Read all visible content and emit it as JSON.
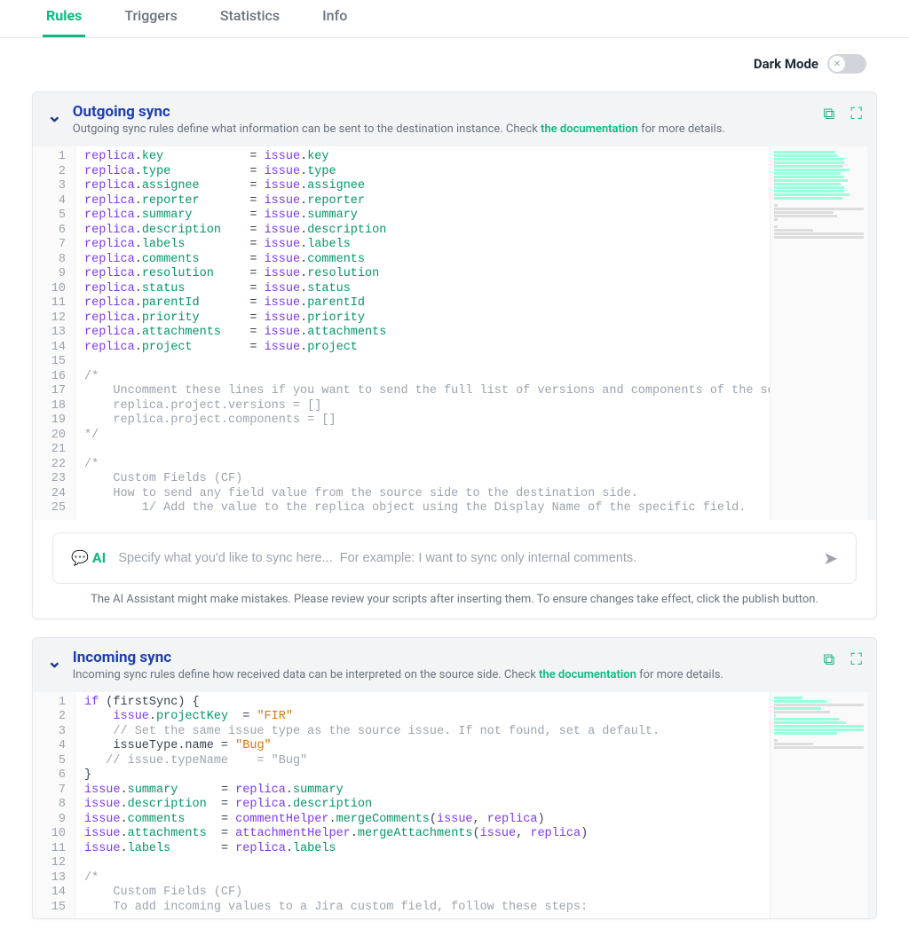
{
  "tabs": {
    "rules": "Rules",
    "triggers": "Triggers",
    "statistics": "Statistics",
    "info": "Info"
  },
  "toolbar": {
    "darkmode": "Dark Mode"
  },
  "outgoing": {
    "title": "Outgoing sync",
    "sub_pre": "Outgoing sync rules define what information can be sent to the destination instance. Check ",
    "doc_link": "the documentation",
    "sub_post": " for more details.",
    "lines": [
      [
        {
          "t": "replica",
          "c": "kw"
        },
        {
          "t": ".",
          "c": "op"
        },
        {
          "t": "key",
          "c": "fn"
        },
        {
          "t": "            = ",
          "c": "op"
        },
        {
          "t": "issue",
          "c": "kw"
        },
        {
          "t": ".",
          "c": "op"
        },
        {
          "t": "key",
          "c": "fn"
        }
      ],
      [
        {
          "t": "replica",
          "c": "kw"
        },
        {
          "t": ".",
          "c": "op"
        },
        {
          "t": "type",
          "c": "fn"
        },
        {
          "t": "           = ",
          "c": "op"
        },
        {
          "t": "issue",
          "c": "kw"
        },
        {
          "t": ".",
          "c": "op"
        },
        {
          "t": "type",
          "c": "fn"
        }
      ],
      [
        {
          "t": "replica",
          "c": "kw"
        },
        {
          "t": ".",
          "c": "op"
        },
        {
          "t": "assignee",
          "c": "fn"
        },
        {
          "t": "       = ",
          "c": "op"
        },
        {
          "t": "issue",
          "c": "kw"
        },
        {
          "t": ".",
          "c": "op"
        },
        {
          "t": "assignee",
          "c": "fn"
        }
      ],
      [
        {
          "t": "replica",
          "c": "kw"
        },
        {
          "t": ".",
          "c": "op"
        },
        {
          "t": "reporter",
          "c": "fn"
        },
        {
          "t": "       = ",
          "c": "op"
        },
        {
          "t": "issue",
          "c": "kw"
        },
        {
          "t": ".",
          "c": "op"
        },
        {
          "t": "reporter",
          "c": "fn"
        }
      ],
      [
        {
          "t": "replica",
          "c": "kw"
        },
        {
          "t": ".",
          "c": "op"
        },
        {
          "t": "summary",
          "c": "fn"
        },
        {
          "t": "        = ",
          "c": "op"
        },
        {
          "t": "issue",
          "c": "kw"
        },
        {
          "t": ".",
          "c": "op"
        },
        {
          "t": "summary",
          "c": "fn"
        }
      ],
      [
        {
          "t": "replica",
          "c": "kw"
        },
        {
          "t": ".",
          "c": "op"
        },
        {
          "t": "description",
          "c": "fn"
        },
        {
          "t": "    = ",
          "c": "op"
        },
        {
          "t": "issue",
          "c": "kw"
        },
        {
          "t": ".",
          "c": "op"
        },
        {
          "t": "description",
          "c": "fn"
        }
      ],
      [
        {
          "t": "replica",
          "c": "kw"
        },
        {
          "t": ".",
          "c": "op"
        },
        {
          "t": "labels",
          "c": "fn"
        },
        {
          "t": "         = ",
          "c": "op"
        },
        {
          "t": "issue",
          "c": "kw"
        },
        {
          "t": ".",
          "c": "op"
        },
        {
          "t": "labels",
          "c": "fn"
        }
      ],
      [
        {
          "t": "replica",
          "c": "kw"
        },
        {
          "t": ".",
          "c": "op"
        },
        {
          "t": "comments",
          "c": "fn"
        },
        {
          "t": "       = ",
          "c": "op"
        },
        {
          "t": "issue",
          "c": "kw"
        },
        {
          "t": ".",
          "c": "op"
        },
        {
          "t": "comments",
          "c": "fn"
        }
      ],
      [
        {
          "t": "replica",
          "c": "kw"
        },
        {
          "t": ".",
          "c": "op"
        },
        {
          "t": "resolution",
          "c": "fn"
        },
        {
          "t": "     = ",
          "c": "op"
        },
        {
          "t": "issue",
          "c": "kw"
        },
        {
          "t": ".",
          "c": "op"
        },
        {
          "t": "resolution",
          "c": "fn"
        }
      ],
      [
        {
          "t": "replica",
          "c": "kw"
        },
        {
          "t": ".",
          "c": "op"
        },
        {
          "t": "status",
          "c": "fn"
        },
        {
          "t": "         = ",
          "c": "op"
        },
        {
          "t": "issue",
          "c": "kw"
        },
        {
          "t": ".",
          "c": "op"
        },
        {
          "t": "status",
          "c": "fn"
        }
      ],
      [
        {
          "t": "replica",
          "c": "kw"
        },
        {
          "t": ".",
          "c": "op"
        },
        {
          "t": "parentId",
          "c": "fn"
        },
        {
          "t": "       = ",
          "c": "op"
        },
        {
          "t": "issue",
          "c": "kw"
        },
        {
          "t": ".",
          "c": "op"
        },
        {
          "t": "parentId",
          "c": "fn"
        }
      ],
      [
        {
          "t": "replica",
          "c": "kw"
        },
        {
          "t": ".",
          "c": "op"
        },
        {
          "t": "priority",
          "c": "fn"
        },
        {
          "t": "       = ",
          "c": "op"
        },
        {
          "t": "issue",
          "c": "kw"
        },
        {
          "t": ".",
          "c": "op"
        },
        {
          "t": "priority",
          "c": "fn"
        }
      ],
      [
        {
          "t": "replica",
          "c": "kw"
        },
        {
          "t": ".",
          "c": "op"
        },
        {
          "t": "attachments",
          "c": "fn"
        },
        {
          "t": "    = ",
          "c": "op"
        },
        {
          "t": "issue",
          "c": "kw"
        },
        {
          "t": ".",
          "c": "op"
        },
        {
          "t": "attachments",
          "c": "fn"
        }
      ],
      [
        {
          "t": "replica",
          "c": "kw"
        },
        {
          "t": ".",
          "c": "op"
        },
        {
          "t": "project",
          "c": "fn"
        },
        {
          "t": "        = ",
          "c": "op"
        },
        {
          "t": "issue",
          "c": "kw"
        },
        {
          "t": ".",
          "c": "op"
        },
        {
          "t": "project",
          "c": "fn"
        }
      ],
      [],
      [
        {
          "t": "/*",
          "c": "cm"
        }
      ],
      [
        {
          "t": "    Uncomment these lines if you want to send the full list of versions and components of the source project.",
          "c": "cm"
        }
      ],
      [
        {
          "t": "    replica.project.versions = []",
          "c": "cm"
        }
      ],
      [
        {
          "t": "    replica.project.components = []",
          "c": "cm"
        }
      ],
      [
        {
          "t": "*/",
          "c": "cm"
        }
      ],
      [],
      [
        {
          "t": "/*",
          "c": "cm"
        }
      ],
      [
        {
          "t": "    Custom Fields (CF)",
          "c": "cm"
        }
      ],
      [
        {
          "t": "    How to send any field value from the source side to the destination side.",
          "c": "cm"
        }
      ],
      [
        {
          "t": "        1/ Add the value to the replica object using the Display Name of the specific field.",
          "c": "cm"
        }
      ]
    ]
  },
  "ai": {
    "badge": "AI",
    "placeholder": "Specify what you'd like to sync here...  For example: I want to sync only internal comments.",
    "note": "The AI Assistant might make mistakes. Please review your scripts after inserting them. To ensure changes take effect, click the publish button."
  },
  "incoming": {
    "title": "Incoming sync",
    "sub_pre": "Incoming sync rules define how received data can be interpreted on the source side. Check ",
    "doc_link": "the documentation",
    "sub_post": " for more details.",
    "lines": [
      [
        {
          "t": "if",
          "c": "kw"
        },
        {
          "t": " (firstSync) {",
          "c": "op"
        }
      ],
      [
        {
          "t": "    issue",
          "c": "kw"
        },
        {
          "t": ".",
          "c": "op"
        },
        {
          "t": "projectKey",
          "c": "fn"
        },
        {
          "t": "  = ",
          "c": "op"
        },
        {
          "t": "\"FIR\"",
          "c": "str"
        }
      ],
      [
        {
          "t": "    // Set the same issue type as the source issue. If not found, set a default.",
          "c": "cm"
        }
      ],
      [
        {
          "t": "    issueType.name = ",
          "c": "op"
        },
        {
          "t": "\"Bug\"",
          "c": "str"
        }
      ],
      [
        {
          "t": "   // issue.typeName    = \"Bug\"",
          "c": "cm"
        }
      ],
      [
        {
          "t": "}",
          "c": "op"
        }
      ],
      [
        {
          "t": "issue",
          "c": "kw"
        },
        {
          "t": ".",
          "c": "op"
        },
        {
          "t": "summary",
          "c": "fn"
        },
        {
          "t": "      = ",
          "c": "op"
        },
        {
          "t": "replica",
          "c": "kw"
        },
        {
          "t": ".",
          "c": "op"
        },
        {
          "t": "summary",
          "c": "fn"
        }
      ],
      [
        {
          "t": "issue",
          "c": "kw"
        },
        {
          "t": ".",
          "c": "op"
        },
        {
          "t": "description",
          "c": "fn"
        },
        {
          "t": "  = ",
          "c": "op"
        },
        {
          "t": "replica",
          "c": "kw"
        },
        {
          "t": ".",
          "c": "op"
        },
        {
          "t": "description",
          "c": "fn"
        }
      ],
      [
        {
          "t": "issue",
          "c": "kw"
        },
        {
          "t": ".",
          "c": "op"
        },
        {
          "t": "comments",
          "c": "fn"
        },
        {
          "t": "     = ",
          "c": "op"
        },
        {
          "t": "commentHelper",
          "c": "kw"
        },
        {
          "t": ".",
          "c": "op"
        },
        {
          "t": "mergeComments",
          "c": "fn"
        },
        {
          "t": "(",
          "c": "op"
        },
        {
          "t": "issue",
          "c": "kw"
        },
        {
          "t": ", ",
          "c": "op"
        },
        {
          "t": "replica",
          "c": "kw"
        },
        {
          "t": ")",
          "c": "op"
        }
      ],
      [
        {
          "t": "issue",
          "c": "kw"
        },
        {
          "t": ".",
          "c": "op"
        },
        {
          "t": "attachments",
          "c": "fn"
        },
        {
          "t": "  = ",
          "c": "op"
        },
        {
          "t": "attachmentHelper",
          "c": "kw"
        },
        {
          "t": ".",
          "c": "op"
        },
        {
          "t": "mergeAttachments",
          "c": "fn"
        },
        {
          "t": "(",
          "c": "op"
        },
        {
          "t": "issue",
          "c": "kw"
        },
        {
          "t": ", ",
          "c": "op"
        },
        {
          "t": "replica",
          "c": "kw"
        },
        {
          "t": ")",
          "c": "op"
        }
      ],
      [
        {
          "t": "issue",
          "c": "kw"
        },
        {
          "t": ".",
          "c": "op"
        },
        {
          "t": "labels",
          "c": "fn"
        },
        {
          "t": "       = ",
          "c": "op"
        },
        {
          "t": "replica",
          "c": "kw"
        },
        {
          "t": ".",
          "c": "op"
        },
        {
          "t": "labels",
          "c": "fn"
        }
      ],
      [],
      [
        {
          "t": "/*",
          "c": "cm"
        }
      ],
      [
        {
          "t": "    Custom Fields (CF)",
          "c": "cm"
        }
      ],
      [
        {
          "t": "    To add incoming values to a Jira custom field, follow these steps:",
          "c": "cm"
        }
      ]
    ]
  }
}
